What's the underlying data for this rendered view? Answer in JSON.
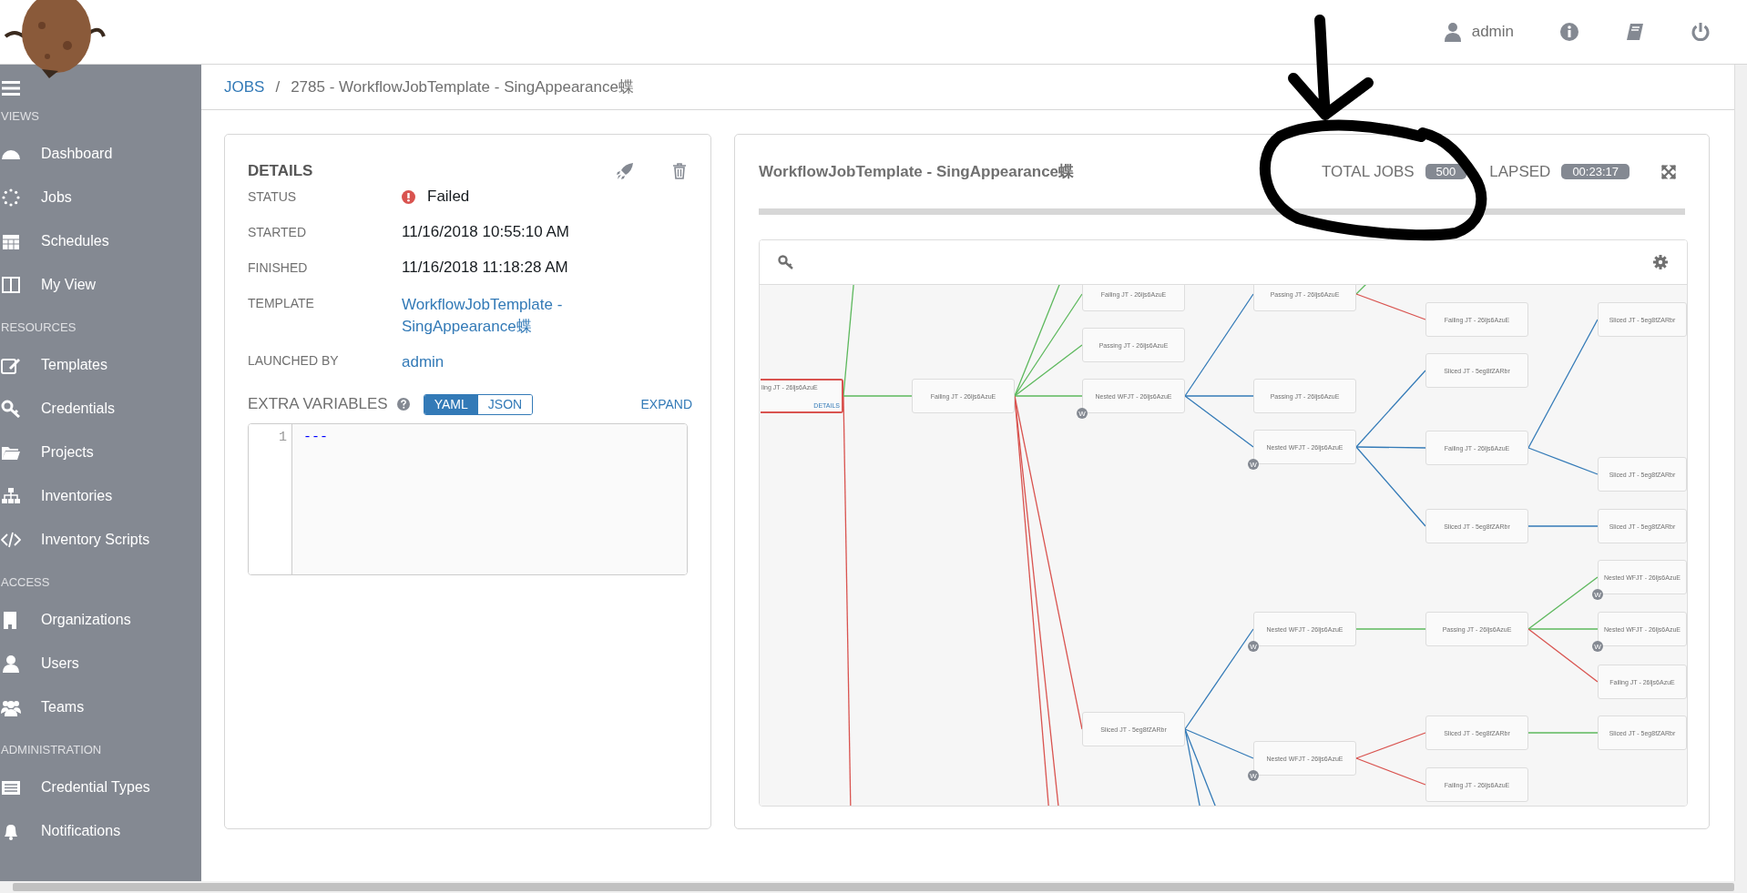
{
  "top_bar": {
    "user": "admin"
  },
  "sidebar": {
    "sections": [
      {
        "heading": "VIEWS",
        "items": [
          {
            "label": "Dashboard"
          },
          {
            "label": "Jobs"
          },
          {
            "label": "Schedules"
          },
          {
            "label": "My View"
          }
        ]
      },
      {
        "heading": "RESOURCES",
        "items": [
          {
            "label": "Templates"
          },
          {
            "label": "Credentials"
          },
          {
            "label": "Projects"
          },
          {
            "label": "Inventories"
          },
          {
            "label": "Inventory Scripts"
          }
        ]
      },
      {
        "heading": "ACCESS",
        "items": [
          {
            "label": "Organizations"
          },
          {
            "label": "Users"
          },
          {
            "label": "Teams"
          }
        ]
      },
      {
        "heading": "ADMINISTRATION",
        "items": [
          {
            "label": "Credential Types"
          },
          {
            "label": "Notifications"
          }
        ]
      }
    ]
  },
  "breadcrumb": {
    "link": "JOBS",
    "separator": "/",
    "current": "2785 - WorkflowJobTemplate - SingAppearance蝶"
  },
  "details": {
    "title": "DETAILS",
    "fields": [
      {
        "label": "STATUS",
        "value": "Failed",
        "kind": "status"
      },
      {
        "label": "STARTED",
        "value": "11/16/2018 10:55:10 AM",
        "kind": "text"
      },
      {
        "label": "FINISHED",
        "value": "11/16/2018 11:18:28 AM",
        "kind": "text"
      },
      {
        "label": "TEMPLATE",
        "value": "WorkflowJobTemplate - SingAppearance蝶",
        "kind": "link"
      },
      {
        "label": "LAUNCHED BY",
        "value": "admin",
        "kind": "link"
      }
    ],
    "extra_variables": {
      "label": "EXTRA VARIABLES",
      "modes": [
        {
          "label": "YAML",
          "selected": true
        },
        {
          "label": "JSON",
          "selected": false
        }
      ],
      "expand": "EXPAND",
      "lines": [
        {
          "number": "1",
          "text": "---"
        }
      ]
    }
  },
  "workflow": {
    "title": "WorkflowJobTemplate - SingAppearance蝶",
    "total_jobs_label": "TOTAL JOBS",
    "total_jobs": "500",
    "elapsed_label": "LAPSED",
    "elapsed": "00:23:17",
    "graph": {
      "root": {
        "label": "ling JT - 26ljs6AzuE",
        "failed": true,
        "link_text": "DETAILS",
        "hidden_links": [
          {
            "kind": "success"
          },
          {
            "kind": "failure"
          }
        ],
        "children": [
          {
            "label": "Failing JT - 26ljs6AzuE",
            "kind": "success",
            "hidden_links": [
              {
                "kind": "success"
              },
              {
                "kind": "failure"
              },
              {
                "kind": "failure"
              }
            ],
            "children": [
              {
                "label": "Failing JT - 26ljs6AzuE",
                "kind": "success"
              },
              {
                "label": "Passing JT - 26ljs6AzuE",
                "kind": "success"
              },
              {
                "label": "Nested WFJT - 26ljs6AzuE",
                "kind": "success",
                "badge": "W",
                "children": [
                  {
                    "label": "Passing JT - 26ljs6AzuE",
                    "kind": "always",
                    "hidden_links": [
                      {
                        "kind": "success"
                      }
                    ],
                    "children": [
                      {
                        "label": "Failing JT - 26ljs6AzuE",
                        "kind": "failure"
                      }
                    ]
                  },
                  {
                    "label": "Passing JT - 26ljs6AzuE",
                    "kind": "always"
                  },
                  {
                    "label": "Nested WFJT - 26ljs6AzuE",
                    "kind": "always",
                    "badge": "W",
                    "children": [
                      {
                        "label": "Sliced JT - 5eg8fZARbr",
                        "kind": "always"
                      },
                      {
                        "label": "Failing JT - 26ljs6AzuE",
                        "kind": "always",
                        "children": [
                          {
                            "label": "Sliced JT - 5eg8fZARbr",
                            "kind": "always"
                          },
                          {
                            "label": "Sliced JT - 5eg8fZARbr",
                            "kind": "always"
                          }
                        ]
                      },
                      {
                        "label": "Sliced JT - 5eg8fZARbr",
                        "kind": "always",
                        "children": [
                          {
                            "label": "Sliced JT - 5eg8fZARbr",
                            "kind": "always"
                          }
                        ]
                      }
                    ]
                  }
                ]
              },
              {
                "label": "Sliced JT - 5eg8fZARbr",
                "kind": "failure",
                "hidden_links": [
                  {
                    "kind": "always"
                  },
                  {
                    "kind": "always"
                  }
                ],
                "children": [
                  {
                    "label": "Nested WFJT - 26ljs6AzuE",
                    "kind": "always",
                    "badge": "W",
                    "children": [
                      {
                        "label": "Passing JT - 26ljs6AzuE",
                        "kind": "success",
                        "children": [
                          {
                            "label": "Nested WFJT - 26ljs6AzuE",
                            "kind": "success",
                            "badge": "W"
                          },
                          {
                            "label": "Nested WFJT - 26ljs6AzuE",
                            "kind": "success",
                            "badge": "W"
                          },
                          {
                            "label": "Failing JT - 26ljs6AzuE",
                            "kind": "failure"
                          }
                        ]
                      }
                    ]
                  },
                  {
                    "label": "Nested WFJT - 26ljs6AzuE",
                    "kind": "always",
                    "badge": "W",
                    "children": [
                      {
                        "label": "Sliced JT - 5eg8fZARbr",
                        "kind": "failure",
                        "children": [
                          {
                            "label": "Sliced JT - 5eg8fZARbr",
                            "kind": "success"
                          }
                        ]
                      },
                      {
                        "label": "Failing JT - 26ljs6AzuE",
                        "kind": "failure"
                      }
                    ]
                  }
                ]
              }
            ]
          }
        ]
      }
    }
  }
}
